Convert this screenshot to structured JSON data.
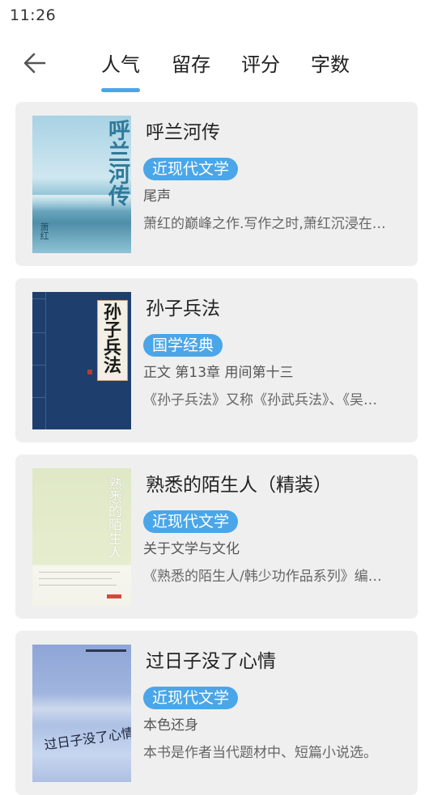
{
  "status": {
    "time": "11:26"
  },
  "nav": {
    "back_icon": "arrow-left-icon",
    "tabs": [
      {
        "label": "人气",
        "active": true
      },
      {
        "label": "留存",
        "active": false
      },
      {
        "label": "评分",
        "active": false
      },
      {
        "label": "字数",
        "active": false
      }
    ]
  },
  "colors": {
    "accent": "#4aa6e8",
    "card_bg": "#efefef"
  },
  "books": [
    {
      "title": "呼兰河传",
      "category": "近现代文学",
      "chapter": "尾声",
      "description": "萧红的巅峰之作.写作之时,萧红沉浸在…",
      "cover": {
        "title_art": "呼兰河传",
        "author_art": "萧红"
      }
    },
    {
      "title": "孙子兵法",
      "category": "国学经典",
      "chapter": "正文 第13章 用间第十三",
      "description": "《孙子兵法》又称《孙武兵法》、《吴…",
      "cover": {
        "title_art": "孙子兵法"
      }
    },
    {
      "title": "熟悉的陌生人（精装）",
      "category": "近现代文学",
      "chapter": "关于文学与文化",
      "description": "《熟悉的陌生人/韩少功作品系列》编…",
      "cover": {
        "title_art": "熟悉的陌生人"
      }
    },
    {
      "title": "过日子没了心情",
      "category": "近现代文学",
      "chapter": "本色还身",
      "description": "本书是作者当代题材中、短篇小说选。",
      "cover": {
        "title_art": "过日子没了心情"
      }
    }
  ]
}
